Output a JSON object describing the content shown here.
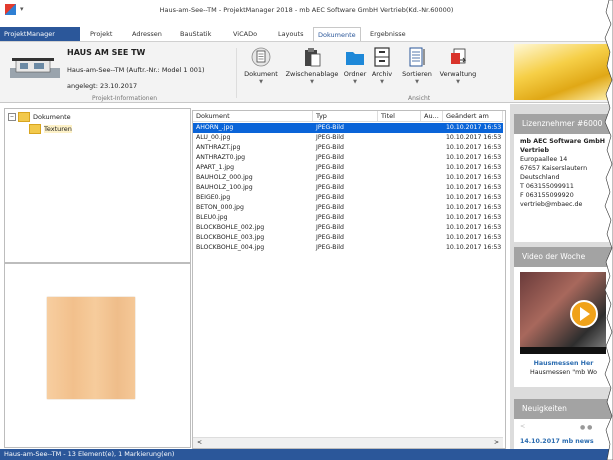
{
  "window": {
    "title": "Haus-am-See--TM - ProjektManager 2018 - mb AEC Software GmbH Vertrieb(Kd.-Nr.60000)",
    "quick_access": "▾"
  },
  "tabs": [
    "ProjektManager",
    "Projekt",
    "Adressen",
    "BauStatik",
    "ViCADo",
    "Layouts",
    "Dokumente",
    "Ergebnisse"
  ],
  "active_tab": "Dokumente",
  "project": {
    "name": "HAUS AM SEE TW",
    "subtitle": "Haus-am-See--TM (Auftr.-Nr.: Model 1 001)",
    "date": "angelegt: 23.10.2017",
    "group_label": "Projekt-Informationen"
  },
  "ribbon": {
    "buttons": [
      "Dokument",
      "Zwischenablage",
      "Ordner",
      "Archiv",
      "Sortieren",
      "Verwaltung"
    ],
    "group_label": "Ansicht"
  },
  "tree": {
    "root": "Dokumente",
    "child": "Texturen",
    "collapse": "−"
  },
  "table": {
    "columns": [
      "Dokument",
      "Typ",
      "Titel",
      "Au...",
      "Geändert am"
    ],
    "rows": [
      {
        "name": "AHORN_.jpg",
        "type": "JPEG-Bild",
        "date": "10.10.2017 16:53"
      },
      {
        "name": "ALU_00.jpg",
        "type": "JPEG-Bild",
        "date": "10.10.2017 16:53"
      },
      {
        "name": "ANTHRAZT.jpg",
        "type": "JPEG-Bild",
        "date": "10.10.2017 16:53"
      },
      {
        "name": "ANTHRAZT0.jpg",
        "type": "JPEG-Bild",
        "date": "10.10.2017 16:53"
      },
      {
        "name": "APART_1.jpg",
        "type": "JPEG-Bild",
        "date": "10.10.2017 16:53"
      },
      {
        "name": "BAUHOLZ_000.jpg",
        "type": "JPEG-Bild",
        "date": "10.10.2017 16:53"
      },
      {
        "name": "BAUHOLZ_100.jpg",
        "type": "JPEG-Bild",
        "date": "10.10.2017 16:53"
      },
      {
        "name": "BEIGE0.jpg",
        "type": "JPEG-Bild",
        "date": "10.10.2017 16:53"
      },
      {
        "name": "BETON_000.jpg",
        "type": "JPEG-Bild",
        "date": "10.10.2017 16:53"
      },
      {
        "name": "BLEU0.jpg",
        "type": "JPEG-Bild",
        "date": "10.10.2017 16:53"
      },
      {
        "name": "BLOCKBOHLE_002.jpg",
        "type": "JPEG-Bild",
        "date": "10.10.2017 16:53"
      },
      {
        "name": "BLOCKBOHLE_003.jpg",
        "type": "JPEG-Bild",
        "date": "10.10.2017 16:53"
      },
      {
        "name": "BLOCKBOHLE_004.jpg",
        "type": "JPEG-Bild",
        "date": "10.10.2017 16:53"
      }
    ],
    "selected_index": 0,
    "scroll_left": "<",
    "scroll_right": ">"
  },
  "license": {
    "header": "Lizenznehmer #6000",
    "lines": [
      "mb AEC Software GmbH",
      "Vertrieb",
      "Europaallee 14",
      "67657 Kaiserslautern",
      "Deutschland",
      "T 063155099911",
      "F 063155099920",
      "vertrieb@mbaec.de"
    ]
  },
  "video": {
    "header": "Video der Woche",
    "link": "Hausmessen Her",
    "caption": "Hausmessen \"mb Wo"
  },
  "news": {
    "header": "Neuigkeiten",
    "item": "14.10.2017 mb news",
    "prev": "<"
  },
  "status": "Haus-am-See--TM - 13 Element(e), 1 Markierung(en)",
  "colors": {
    "accent": "#2b579a",
    "selection": "#0a64d8",
    "texture": "#f4c896"
  }
}
